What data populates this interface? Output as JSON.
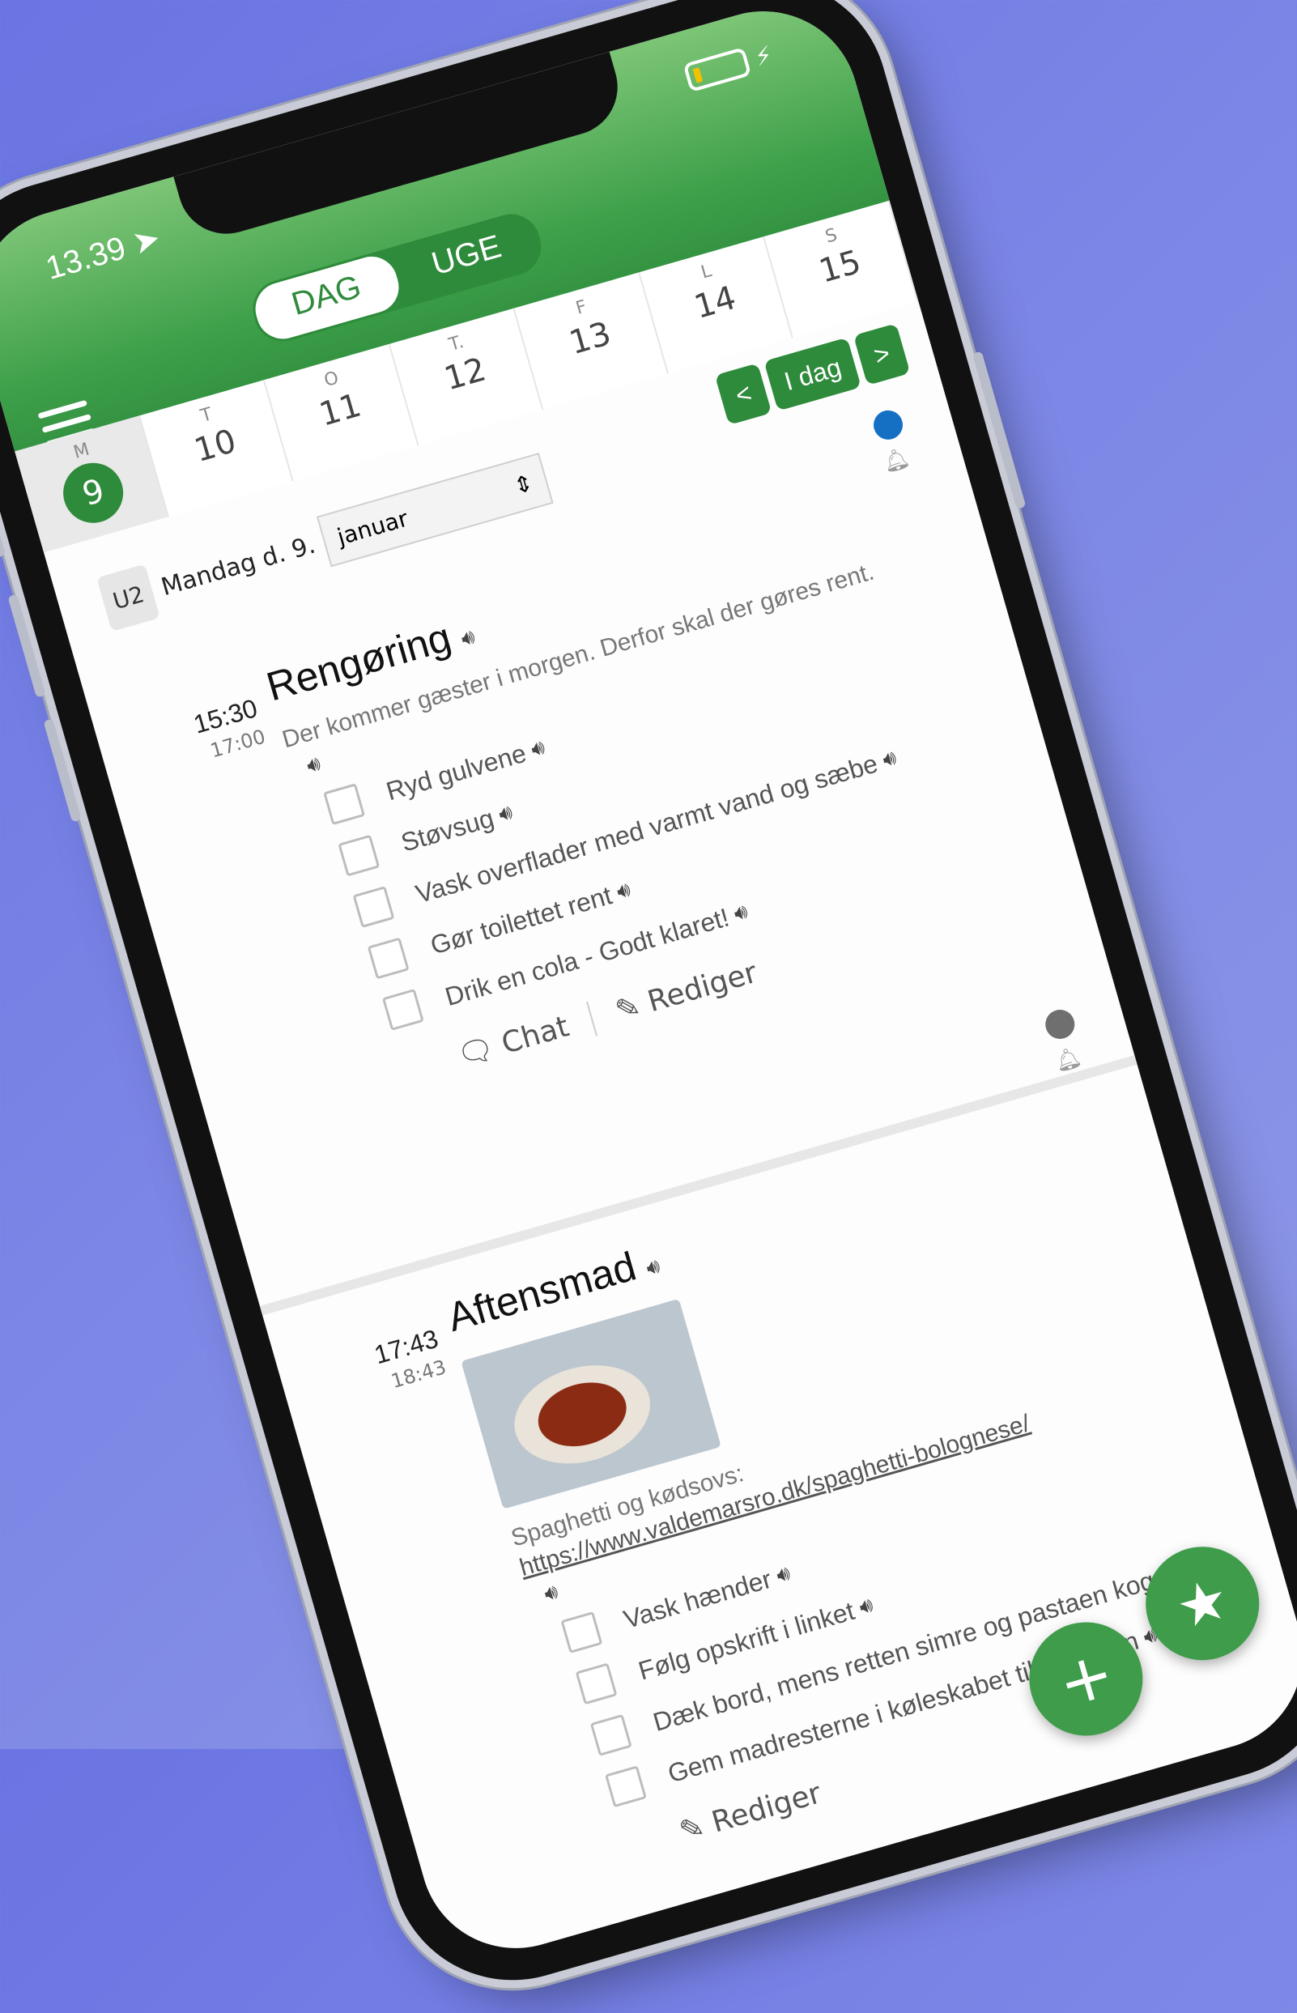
{
  "status_bar": {
    "time": "13.39"
  },
  "view_toggle": {
    "day": "DAG",
    "week": "UGE"
  },
  "week_days": [
    {
      "letter": "M",
      "num": "9"
    },
    {
      "letter": "T",
      "num": "10"
    },
    {
      "letter": "O",
      "num": "11"
    },
    {
      "letter": "T.",
      "num": "12"
    },
    {
      "letter": "F",
      "num": "13"
    },
    {
      "letter": "L",
      "num": "14"
    },
    {
      "letter": "S",
      "num": "15"
    }
  ],
  "nav": {
    "prev": "<",
    "today": "I dag",
    "next": ">"
  },
  "date_header": {
    "week_label": "U2",
    "date": "Mandag d. 9.",
    "month": "januar"
  },
  "tasks": [
    {
      "start": "15:30",
      "end": "17:00",
      "title": "Rengøring",
      "description": "Der kommer gæster i morgen. Derfor skal der gøres rent.",
      "items": [
        "Ryd gulvene",
        "Støvsug",
        "Vask overflader med varmt vand og sæbe",
        "Gør toilettet rent",
        "Drik en cola - Godt klaret!"
      ],
      "chat": "Chat",
      "edit": "Rediger"
    },
    {
      "start": "17:43",
      "end": "18:43",
      "title": "Aftensmad",
      "description": "Spaghetti og kødsovs:",
      "link": "https://www.valdemarsro.dk/spaghetti-bolognese/",
      "items": [
        "Vask hænder",
        "Følg opskrift i linket",
        "Dæk bord, mens retten simre og pastaen koger",
        "Gem madresterne i køleskabet til i morgen"
      ],
      "edit": "Rediger"
    }
  ],
  "fab": {
    "add": "+",
    "favorite": "★"
  },
  "colors": {
    "brand_green": "#2e8b3b",
    "header_light": "#7cc576",
    "dot_blue": "#1570c4",
    "dot_gray": "#6f6f6f"
  }
}
